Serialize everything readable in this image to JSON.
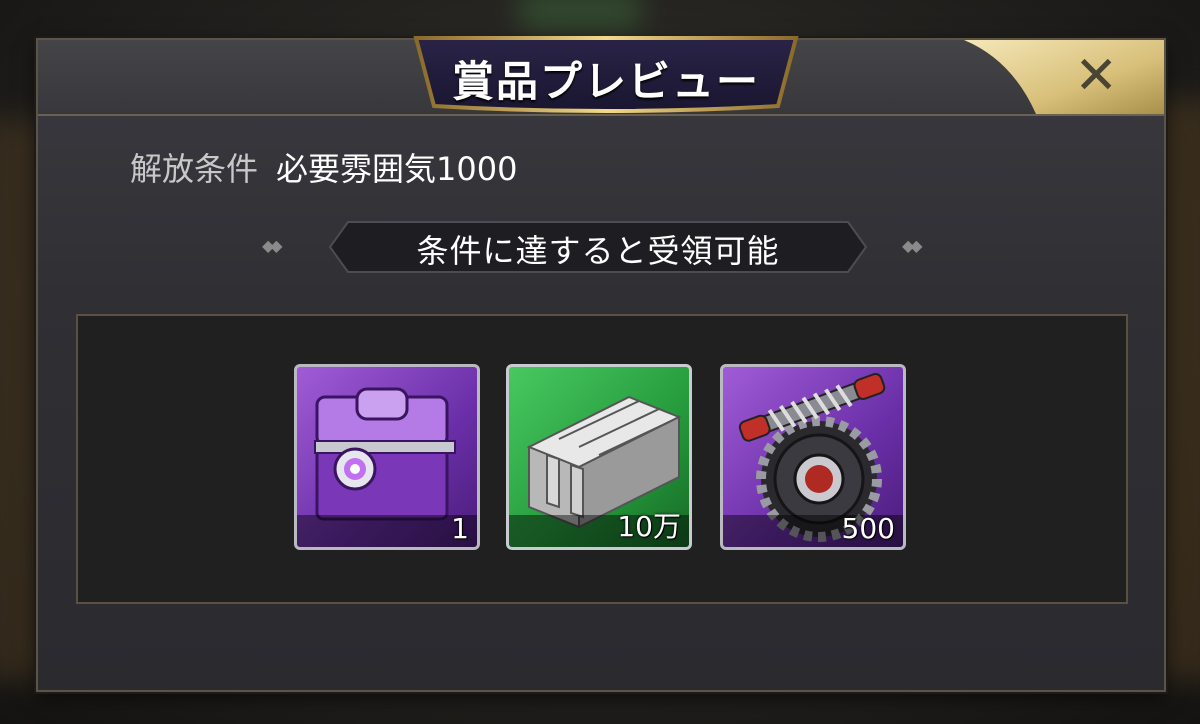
{
  "dialog": {
    "title": "賞品プレビュー",
    "close_symbol": "✕"
  },
  "condition": {
    "label": "解放条件",
    "value": "必要雰囲気1000"
  },
  "banner": {
    "text": "条件に達すると受領可能"
  },
  "rewards": [
    {
      "icon": "purple-chest-icon",
      "quantity": "1"
    },
    {
      "icon": "metal-rails-icon",
      "quantity": "10万"
    },
    {
      "icon": "gear-worm-icon",
      "quantity": "500"
    }
  ],
  "colors": {
    "panel_border": "#5a5140",
    "gold_accent": "#d8c07a",
    "purple_rarity": "#8a45c8",
    "green_rarity": "#2fae48"
  }
}
